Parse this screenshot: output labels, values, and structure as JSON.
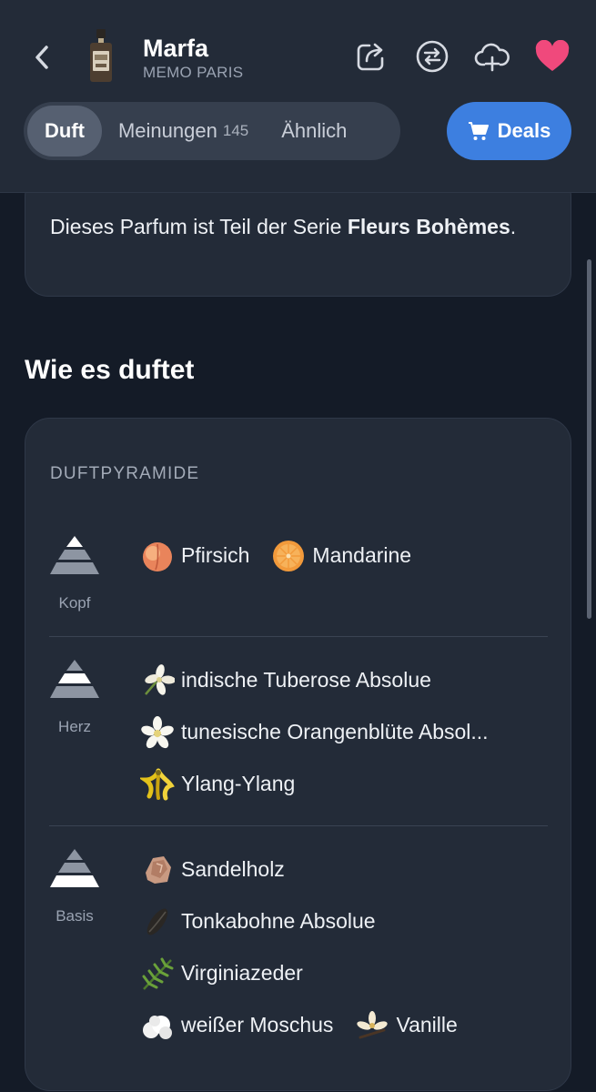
{
  "header": {
    "title": "Marfa",
    "brand": "MEMO PARIS",
    "tabs": [
      {
        "label": "Duft",
        "count": ""
      },
      {
        "label": "Meinungen",
        "count": "145"
      },
      {
        "label": "Ähnlich",
        "count": ""
      }
    ],
    "deals_label": "Deals",
    "accent": "#3d7fe0",
    "heart_color": "#f0497c",
    "icons": [
      "chevron-left-icon",
      "share-icon",
      "compare-icon",
      "cloud-add-icon",
      "heart-icon",
      "cart-icon"
    ]
  },
  "series": {
    "prefix": "Dieses Parfum ist Teil der Serie ",
    "name": "Fleurs Bohèmes",
    "suffix": "."
  },
  "section_title": "Wie es duftet",
  "pyramid": {
    "label": "DUFTPYRAMIDE",
    "tiers": [
      {
        "name": "Kopf",
        "rows": [
          [
            {
              "name": "Pfirsich",
              "icon": "peach-icon"
            },
            {
              "name": "Mandarine",
              "icon": "mandarin-icon"
            }
          ]
        ]
      },
      {
        "name": "Herz",
        "rows": [
          [
            {
              "name": "indische Tuberose Absolue",
              "icon": "tuberose-icon"
            }
          ],
          [
            {
              "name": "tunesische Orangenblüte Absol...",
              "icon": "orange-blossom-icon"
            }
          ],
          [
            {
              "name": "Ylang-Ylang",
              "icon": "ylang-ylang-icon"
            }
          ]
        ]
      },
      {
        "name": "Basis",
        "rows": [
          [
            {
              "name": "Sandelholz",
              "icon": "sandalwood-icon"
            }
          ],
          [
            {
              "name": "Tonkabohne Absolue",
              "icon": "tonka-bean-icon"
            }
          ],
          [
            {
              "name": "Virginiazeder",
              "icon": "cedar-icon"
            }
          ],
          [
            {
              "name": "weißer Moschus",
              "icon": "white-musk-icon"
            },
            {
              "name": "Vanille",
              "icon": "vanilla-icon"
            }
          ]
        ]
      }
    ]
  }
}
